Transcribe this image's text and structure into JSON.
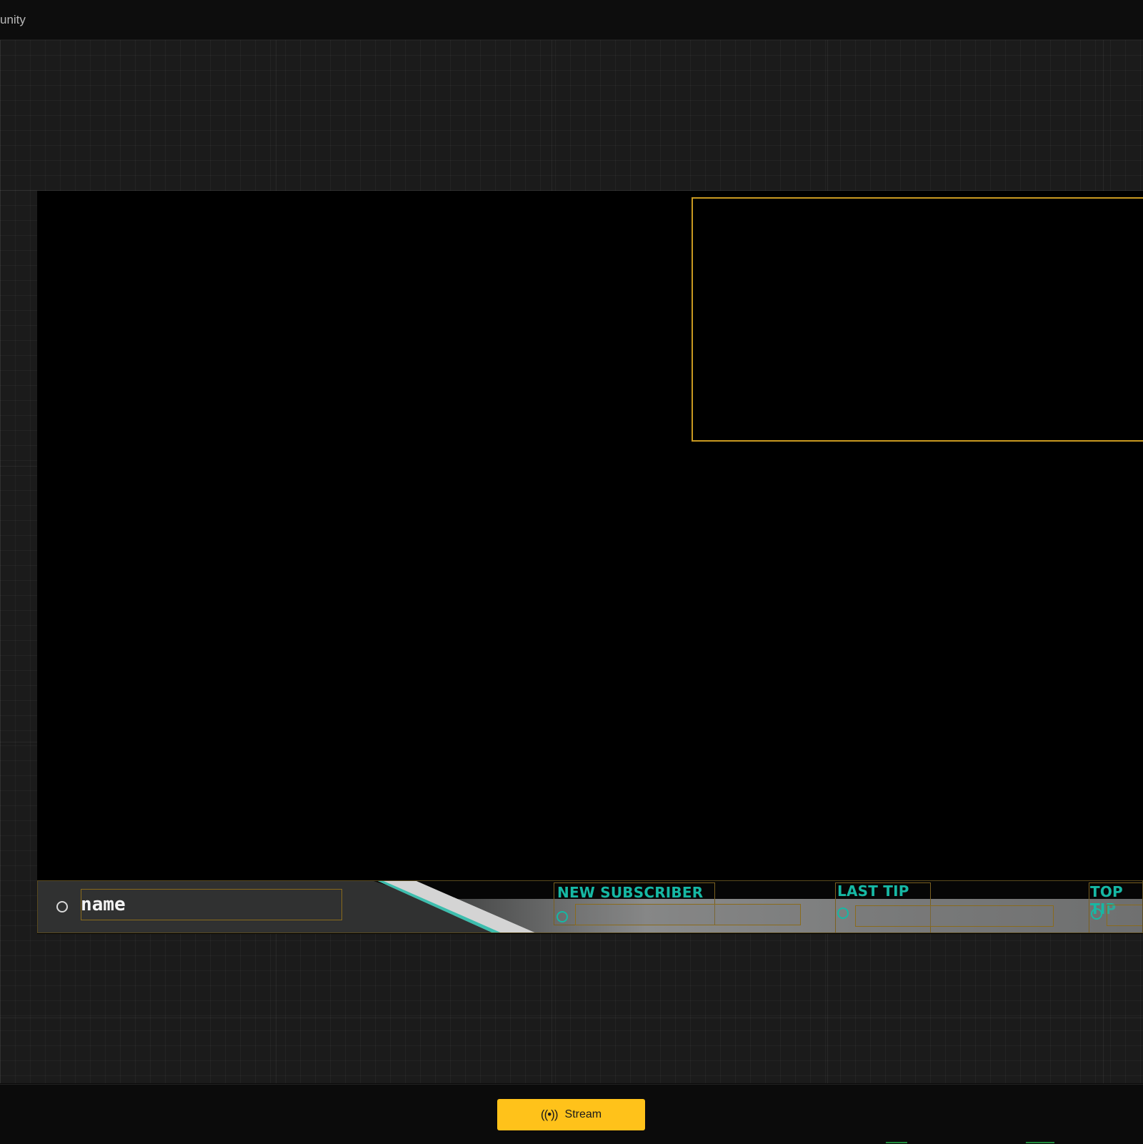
{
  "app": {
    "title": "unity"
  },
  "scene": {
    "name_label": "name",
    "widgets": [
      {
        "label": "NEW SUBSCRIBER"
      },
      {
        "label": "LAST TIP"
      },
      {
        "label": "TOP TIP"
      }
    ]
  },
  "toolbar": {
    "stream_icon": "((•))",
    "stream_label": "Stream"
  },
  "colors": {
    "accent": "#ffc21a",
    "frame": "#c99a21",
    "teal": "#16b8a4"
  }
}
